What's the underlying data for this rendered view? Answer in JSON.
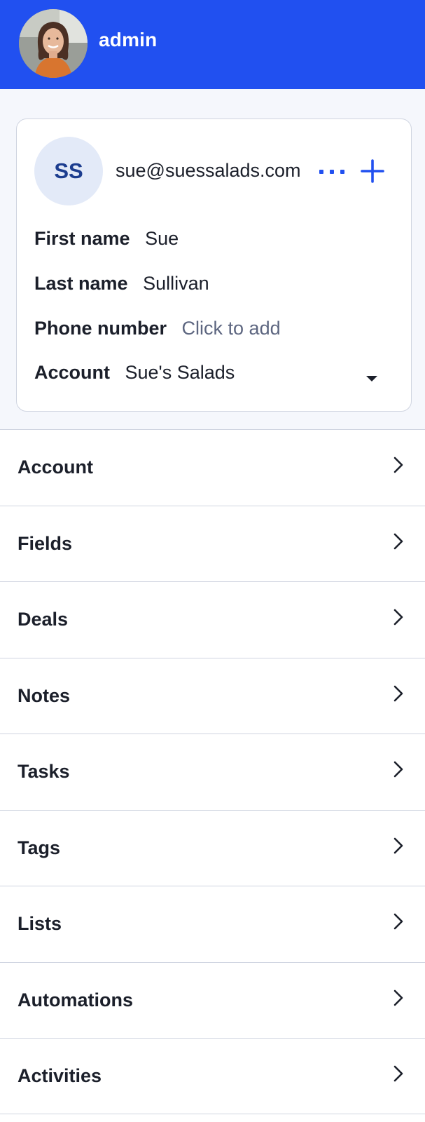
{
  "header": {
    "username": "admin",
    "avatar_icon": "user-avatar-photo"
  },
  "contact": {
    "initials": "SS",
    "email": "sue@suessalads.com",
    "more_icon": "more-horizontal-icon",
    "add_icon": "plus-icon",
    "fields": {
      "first_name_label": "First name",
      "first_name_value": "Sue",
      "last_name_label": "Last name",
      "last_name_value": "Sullivan",
      "phone_label": "Phone number",
      "phone_placeholder": "Click to add",
      "account_label": "Account",
      "account_value": "Sue's Salads"
    }
  },
  "nav": {
    "items": [
      {
        "label": "Account"
      },
      {
        "label": "Fields"
      },
      {
        "label": "Deals"
      },
      {
        "label": "Notes"
      },
      {
        "label": "Tasks"
      },
      {
        "label": "Tags"
      },
      {
        "label": "Lists"
      },
      {
        "label": "Automations"
      },
      {
        "label": "Activities"
      }
    ]
  },
  "colors": {
    "brand_blue": "#2150f0",
    "initials_bg": "#e3eaf8",
    "initials_text": "#1c3d8f",
    "page_band": "#f5f7fc",
    "divider": "#cfd4e0",
    "placeholder_text": "#5d6680"
  }
}
